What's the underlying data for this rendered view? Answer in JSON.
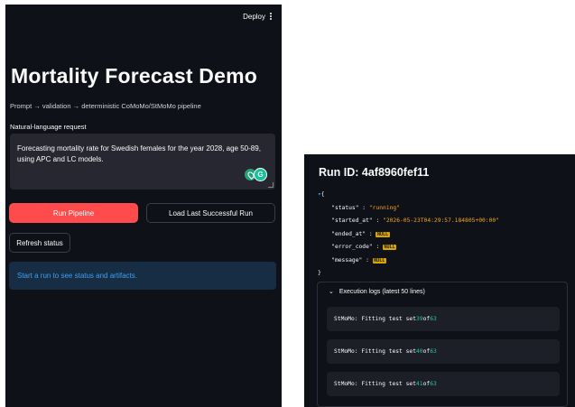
{
  "header": {
    "deploy_label": "Deploy"
  },
  "page": {
    "title": "Mortality Forecast Demo",
    "subtitle": "Prompt → validation → deterministic CoMoMo/StMoMo pipeline",
    "request_label": "Natural-language request",
    "request_value": "Forecasting mortality rate for Swedish females for the year 2028, age 50-89, using APC and LC models."
  },
  "buttons": {
    "run": "Run Pipeline",
    "load": "Load Last Successful Run",
    "refresh": "Refresh status"
  },
  "info_message": "Start a run to see status and artifacts.",
  "run": {
    "title": "Run ID: 4af8960fef11",
    "open_brace": "{",
    "close_brace": "}",
    "fields": [
      {
        "key": "\"status\"",
        "value": "\"running\""
      },
      {
        "key": "\"started_at\"",
        "value": "\"2026-05-23T04:29:57.184805+00:00\""
      },
      {
        "key": "\"ended_at\"",
        "value": "NULL"
      },
      {
        "key": "\"error_code\"",
        "value": "NULL"
      },
      {
        "key": "\"message\"",
        "value": "NULL"
      }
    ],
    "logs_label": "Execution logs (latest 50 lines)",
    "logs": [
      {
        "prefix": "StMoMo: Fitting test set ",
        "n": "39",
        "mid": " of ",
        "total": "63"
      },
      {
        "prefix": "StMoMo: Fitting test set ",
        "n": "40",
        "mid": " of ",
        "total": "63"
      },
      {
        "prefix": "StMoMo: Fitting test set ",
        "n": "41",
        "mid": " of ",
        "total": "63"
      }
    ]
  },
  "colors": {
    "primary": "#ff4b4b",
    "info_bg": "#172d43",
    "info_text": "#3f9ff5",
    "bg": "#0e1117"
  }
}
